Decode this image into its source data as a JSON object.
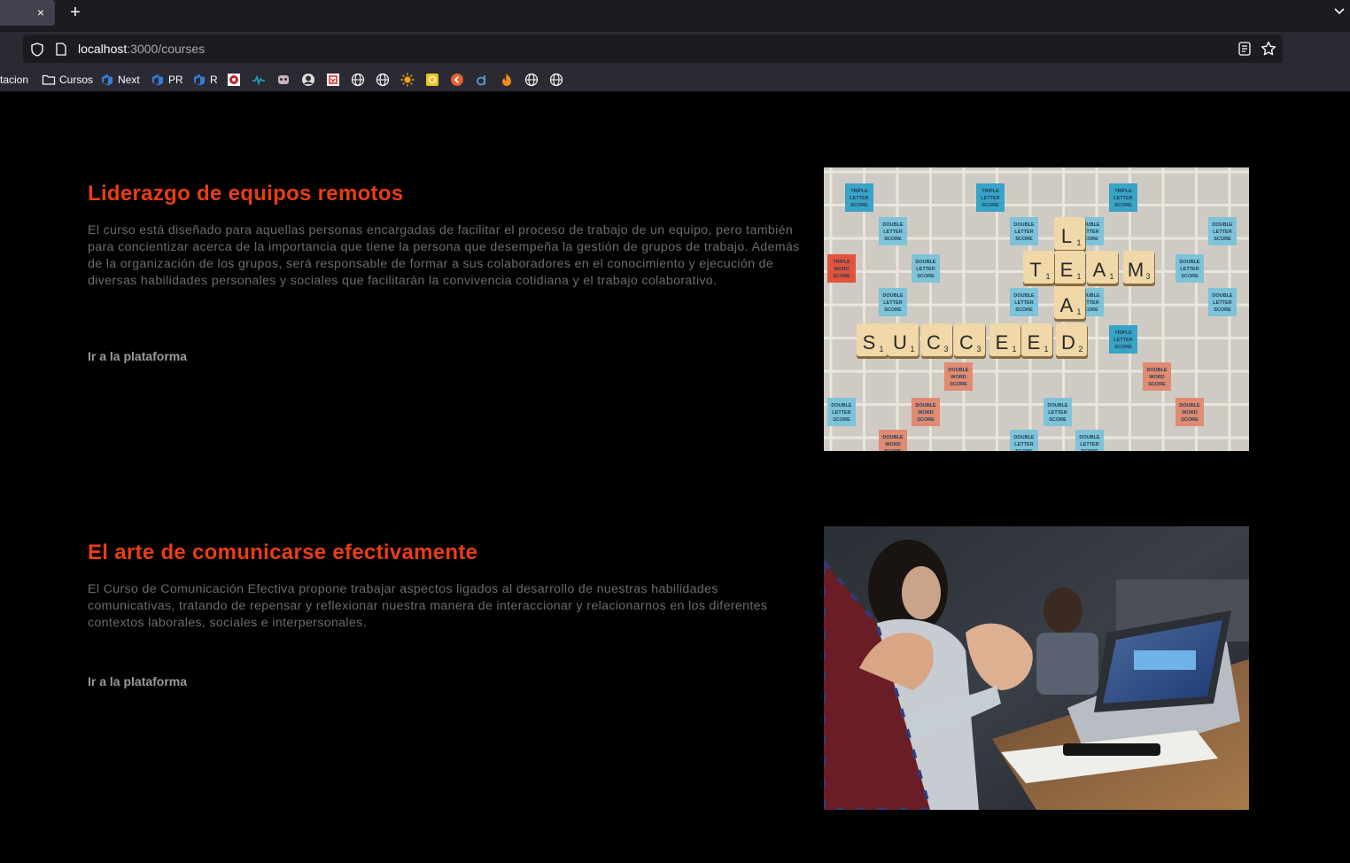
{
  "browser": {
    "tab_close": "×",
    "new_tab": "+",
    "url": {
      "host": "localhost",
      "path": ":3000/courses"
    },
    "bookmarks": [
      {
        "label": "tacion",
        "icon": ""
      },
      {
        "label": "Cursos",
        "icon": "folder-icon"
      },
      {
        "label": "Next",
        "icon": "azure-devops-icon"
      },
      {
        "label": "PR",
        "icon": "azure-devops-icon"
      },
      {
        "label": "R",
        "icon": "azure-devops-icon"
      },
      {
        "label": "",
        "icon": "red-circle-site-icon"
      },
      {
        "label": "",
        "icon": "wave-site-icon"
      },
      {
        "label": "",
        "icon": "mascot-site-icon"
      },
      {
        "label": "",
        "icon": "avatar-site-icon"
      },
      {
        "label": "",
        "icon": "red-badge-site-icon"
      },
      {
        "label": "",
        "icon": "globe-icon"
      },
      {
        "label": "",
        "icon": "globe-icon"
      },
      {
        "label": "",
        "icon": "sun-icon"
      },
      {
        "label": "",
        "icon": "yellow-square-icon"
      },
      {
        "label": "",
        "icon": "orange-circle-icon"
      },
      {
        "label": "",
        "icon": "blue-d-icon"
      },
      {
        "label": "",
        "icon": "fire-icon"
      },
      {
        "label": "",
        "icon": "globe-icon"
      },
      {
        "label": "",
        "icon": "globe-icon"
      }
    ]
  },
  "courses": [
    {
      "title": "Liderazgo de equipos remotos",
      "description": "El curso está diseñado para aquellas personas encargadas de facilitar el proceso de trabajo de un equipo, pero también para concientizar acerca de la importancia que tiene la persona que desempeña la gestión de grupos de trabajo. Además de la organización de los grupos, será responsable de formar a sus colaboradores en el conocimiento y ejecución de diversas habilidades personales y sociales que facilitarán la convivencia cotidiana y el trabajo colaborativo.",
      "link": "Ir a la plataforma",
      "image": {
        "tiles": [
          "L1",
          "E1",
          "A1",
          "T1",
          "A1",
          "M3",
          "S1",
          "U1",
          "C3",
          "C3",
          "E1",
          "E1",
          "D2"
        ],
        "premium_labels": [
          "TRIPLE LETTER SCORE",
          "DOUBLE LETTER SCORE",
          "DOUBLE WORD SCORE",
          "TRIPLE WORD SCORE"
        ]
      }
    },
    {
      "title": "El arte de comunicarse efectivamente",
      "description": "El Curso de Comunicación Efectiva propone trabajar aspectos ligados al desarrollo de nuestras habilidades comunicativas, tratando de repensar y reflexionar nuestra manera de interaccionar y relacionarnos en los diferentes contextos laborales, sociales e interpersonales.",
      "link": "Ir a la plataforma"
    }
  ],
  "colors": {
    "accent": "#ea3d12",
    "description": "#6c6c6c",
    "link": "#9a9a9a",
    "background": "#000000"
  }
}
